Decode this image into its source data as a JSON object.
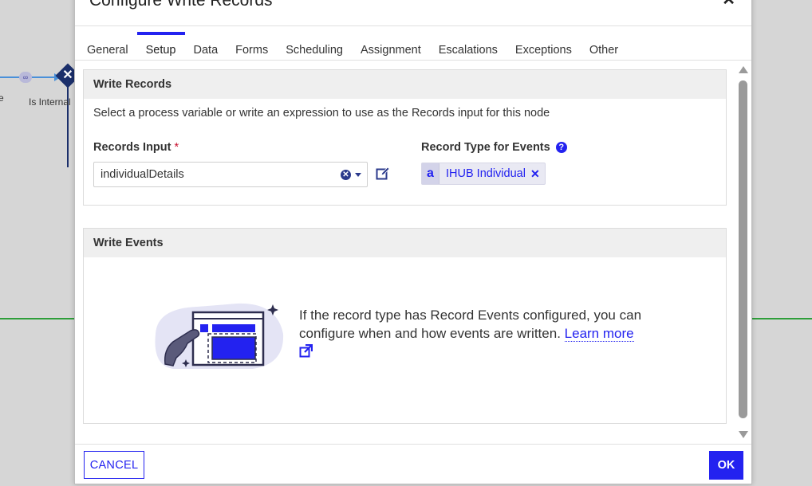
{
  "canvas": {
    "node_label_left": "e",
    "gateway_label": "Is Internal Portal",
    "flow_link_glyph": "∞"
  },
  "dialog": {
    "title": "Configure Write Records",
    "close_glyph": "✕",
    "tabs": [
      {
        "label": "General",
        "active": false
      },
      {
        "label": "Setup",
        "active": true
      },
      {
        "label": "Data",
        "active": false
      },
      {
        "label": "Forms",
        "active": false
      },
      {
        "label": "Scheduling",
        "active": false
      },
      {
        "label": "Assignment",
        "active": false
      },
      {
        "label": "Escalations",
        "active": false
      },
      {
        "label": "Exceptions",
        "active": false
      },
      {
        "label": "Other",
        "active": false
      }
    ]
  },
  "write_records": {
    "heading": "Write Records",
    "instructions": "Select a process variable or write an expression to use as the Records input for this node",
    "records_input": {
      "label": "Records Input",
      "required_mark": "*",
      "value": "individualDetails"
    },
    "record_type": {
      "label": "Record Type for Events",
      "help_glyph": "?",
      "chip_icon_glyph": "a",
      "chip_text": "IHUB Individual",
      "chip_remove_glyph": "✕"
    }
  },
  "write_events": {
    "heading": "Write Events",
    "message": "If the record type has Record Events configured, you can configure when and how events are written.",
    "link_text": "Learn more"
  },
  "footer": {
    "cancel_label": "CANCEL",
    "ok_label": "OK"
  },
  "colors": {
    "accent": "#2322f0",
    "header_bg": "#efefef",
    "canvas_bg": "#d6d6d6",
    "flow_green": "#2e9e3a",
    "flow_blue": "#4a90d9",
    "required": "#c8102e"
  },
  "icons": {
    "edit": "edit-icon",
    "clear": "clear-icon",
    "caret": "chevron-down-icon",
    "external": "external-link-icon",
    "help": "help-icon"
  }
}
